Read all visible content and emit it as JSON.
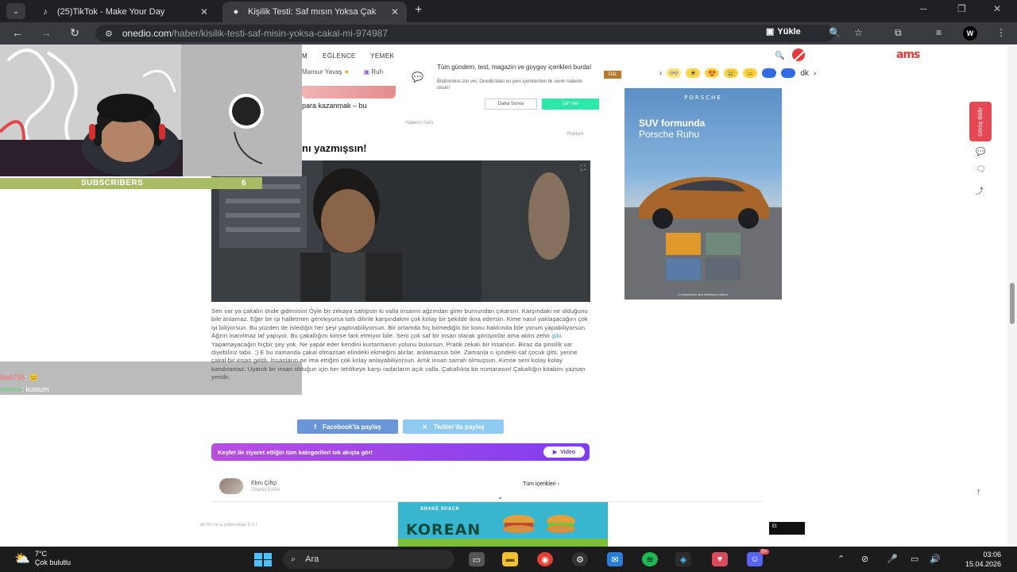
{
  "browser": {
    "tabs": [
      {
        "title": "(25)TikTok - Make Your Day",
        "active": false
      },
      {
        "title": "Kişilik Testi: Saf mısın Yoksa Çak",
        "active": true
      }
    ],
    "url_host": "onedio.com",
    "url_path": "/haber/kisilik-testi-saf-misin-yoksa-cakal-mi-974987",
    "yukle_label": "Yükle",
    "profile_initial": "W"
  },
  "site": {
    "nav": [
      "M",
      "EĞLENCE",
      "YEMEK"
    ],
    "ticker": "Mansur Yavaş",
    "ticker2": "Ruh",
    "ams_logo": "ams",
    "reactions_more": "dk"
  },
  "notification": {
    "title": "Tüm gündem, test, magazin ve goygoy içerikleri burda!",
    "text": "Bildirimlere izin ver, Onedio'daki en yeni içeriklerden ilk senin haberin olsun!",
    "later": "Daha Sonra",
    "allow": "İzin Ver"
  },
  "snippet": "para kazanmak – bu",
  "ad_kicker": "Haberin Sürü",
  "ad_label": "Reklam",
  "dilz_tag": "Dilz",
  "headline": "nı yazmışsın!",
  "article": {
    "p1": "Sen var ya çakalın önde gidenisin! Öyle bir zekaya sahipsin ki valla insanın ağzından girer burnundan çıkarsın. Karşındaki ne olduğunu bile anlamaz. Eğer bir işi halletmen gerekiyorsa tatlı dilinle karşındakini çok kolay bir şekilde ikna edersin. Kime nasıl yaklaşacağını çok iyi biliyorsun. Bu yüzden de istediğin her şeyi yaptırabiliyorsun. Bir ortamda hiç bilmediğin bir konu hakkında bile yorum yapabiliyorsun. Ağzın inanılmaz laf yapıyor. Bu çakallığını kimse fark etmiyor bile. Seni çok saf bir insan olarak görüyorlar ama aklın zehir",
    "p_link": "gibi",
    "p2": ". Yapamayacağın hiçbir şey yok. Ne yapar eder kendini kurtarmanın yolunu bulursun. Pratik zekalı bir insansın. Biraz da şinsilik var diyebiliriz tabii. :) E bu zamanda çakal olmazsan elindeki ekmeğini alırlar, anlamazsın bile. Zamanla o içindeki saf çocuk gitti, yerine çakal bir insan geldi. İnsanların ne ima ettiğini çok kolay anlayabiliyorsun. Artık insan sarrafı olmuşsun. Kimse seni kolay kolay kandıramaz. Uyanık bir insan olduğun için her tehlikeye karşı radarların açık valla. Çakallıkta bir numarasın! Çakallığın kitabını yazsan yeridir."
  },
  "share": {
    "facebook": "Facebook'ta paylaş",
    "twitter": "Twitter'da paylaş"
  },
  "explore": {
    "text": "Keşfet ile ziyaret ettiğin tüm kategorileri tek akışta gör!",
    "video": "Video"
  },
  "author": {
    "name": "Ebru Çiftçi",
    "role": "Onedio Editör",
    "all": "Tüm içerikleri"
  },
  "right_ad": {
    "brand": "PORSCHE",
    "line1": "SUV formunda",
    "line2": "Porsche Ruhu",
    "footer": "Consumption and emissions values"
  },
  "rail": {
    "feedback": "Görüş Bildir"
  },
  "bottom_ad": {
    "brand": "SHAKE SHACK",
    "word": "KOREAN"
  },
  "black_tag": "Et",
  "side_faded": "ek bir ne a çekeceklar k u l",
  "stream": {
    "subscribers_label": "SUBSCRIBERS",
    "subscribers_count": "6",
    "chat": [
      {
        "user": "tila8765",
        "msg": ""
      },
      {
        "user": "reenve",
        "msg": "kustum"
      }
    ]
  },
  "taskbar": {
    "temp": "7°C",
    "weather": "Çok bulutlu",
    "search": "Ara",
    "time": "03:06",
    "date": "15.04.2026",
    "discord_badge": "9+"
  },
  "colors": {
    "accent_green": "#2ee6a8",
    "explore_purple": "#8a3fe6",
    "subscriber_bar": "#a7bc63",
    "rail_red": "#e44954"
  }
}
